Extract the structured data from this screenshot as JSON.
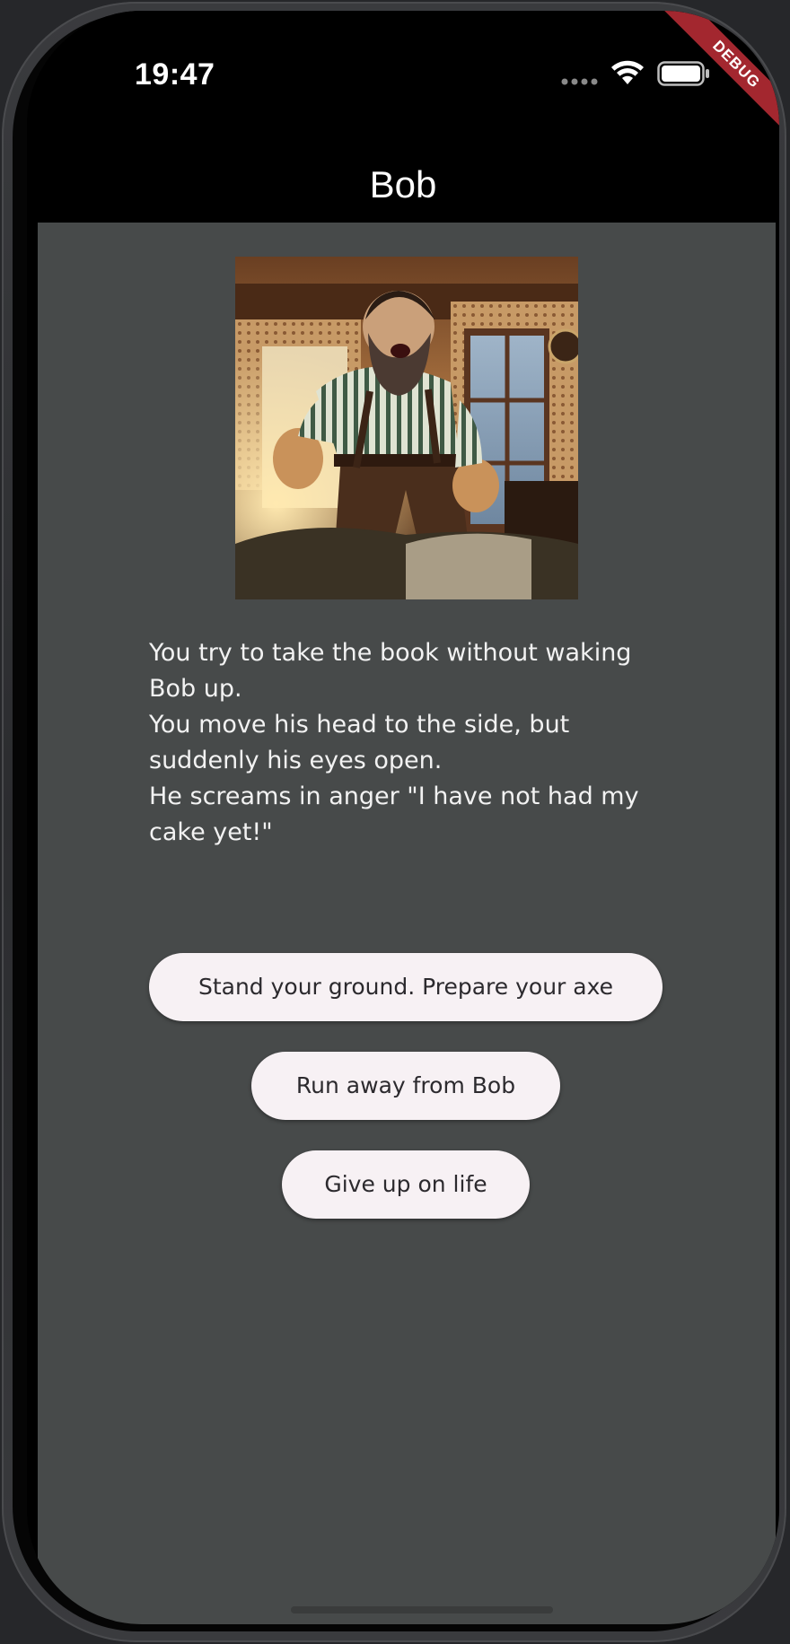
{
  "status_bar": {
    "time": "19:47",
    "debug_label": "DEBUG"
  },
  "app_bar": {
    "title": "Bob"
  },
  "story": {
    "text": "You try to take the book without waking Bob up.\nYou move his head to the side, but suddenly his eyes open.\nHe screams in anger \"I have not had my cake yet!\""
  },
  "choices": [
    {
      "label": "Stand your ground. Prepare your axe"
    },
    {
      "label": "Run away from Bob"
    },
    {
      "label": "Give up on life"
    }
  ],
  "icons": {
    "signal": "cellular-signal-icon",
    "wifi": "wifi-icon",
    "battery": "battery-icon"
  },
  "colors": {
    "background": "#474a4a",
    "app_bar": "#000000",
    "button": "#f7f1f4",
    "button_text": "#2c2a2e",
    "debug_banner": "#a3272f"
  }
}
